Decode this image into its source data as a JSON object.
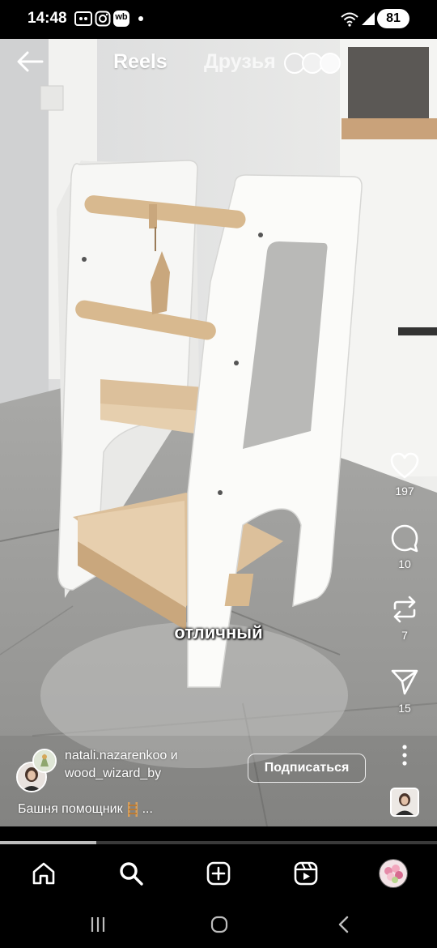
{
  "status_bar": {
    "time": "14:48",
    "icons": [
      "screen-record-icon",
      "instagram-icon",
      "wb-icon",
      "notification-dot-icon",
      "wifi-icon",
      "signal-icon"
    ],
    "battery": "81",
    "wb_badge": "wb"
  },
  "header": {
    "tab_reels": "Reels",
    "tab_friends": "Друзья"
  },
  "video": {
    "caption_overlay": "отличный",
    "progress": 0.22
  },
  "actions": {
    "likes": "197",
    "comments": "10",
    "reposts": "7",
    "shares": "15"
  },
  "post": {
    "author_line1": "natali.nazarenkoo и",
    "author_line2": "wood_wizard_by",
    "subscribe_label": "Подписаться",
    "description": "Башня помощник",
    "description_suffix": "..."
  },
  "colors": {
    "background": "#000000",
    "text": "#ffffff",
    "progress_fill": "#bdbdbd",
    "wood": "#d9b98f",
    "white_panel": "#f7f7f5"
  }
}
